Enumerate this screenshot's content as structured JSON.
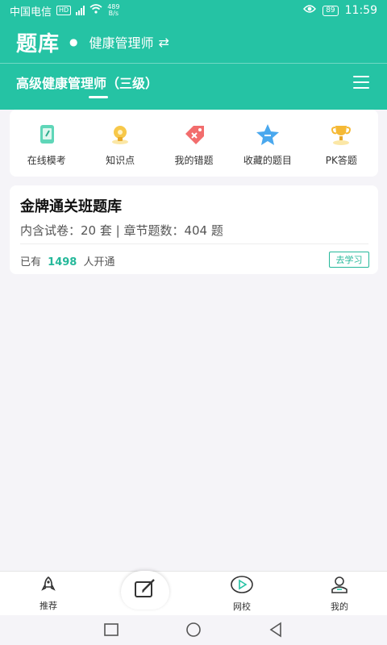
{
  "status_bar": {
    "carrier": "中国电信",
    "hd": "HD",
    "net_speed_value": "489",
    "net_speed_unit": "B/s",
    "battery": "89",
    "time": "11:59"
  },
  "header": {
    "title": "题库",
    "subject": "健康管理师",
    "level": "高级健康管理师（三级）"
  },
  "quick_actions": [
    {
      "label": "在线模考",
      "icon": "exam-tablet-icon"
    },
    {
      "label": "知识点",
      "icon": "lightbulb-icon"
    },
    {
      "label": "我的错题",
      "icon": "wrong-tag-icon"
    },
    {
      "label": "收藏的题目",
      "icon": "star-icon"
    },
    {
      "label": "PK答题",
      "icon": "trophy-icon"
    }
  ],
  "bank": {
    "title": "金牌通关班题库",
    "info": "内含试卷：20 套 | 章节题数：404 题",
    "foot_prefix": "已有",
    "count": "1498",
    "foot_suffix": "人开通",
    "button": "去学习"
  },
  "tabs": [
    {
      "label": "推荐",
      "icon": "rocket-icon"
    },
    {
      "label": "",
      "icon": "edit-icon"
    },
    {
      "label": "网校",
      "icon": "play-icon"
    },
    {
      "label": "我的",
      "icon": "user-icon"
    }
  ],
  "colors": {
    "accent": "#25c3a4",
    "count_green": "#25b89a"
  }
}
